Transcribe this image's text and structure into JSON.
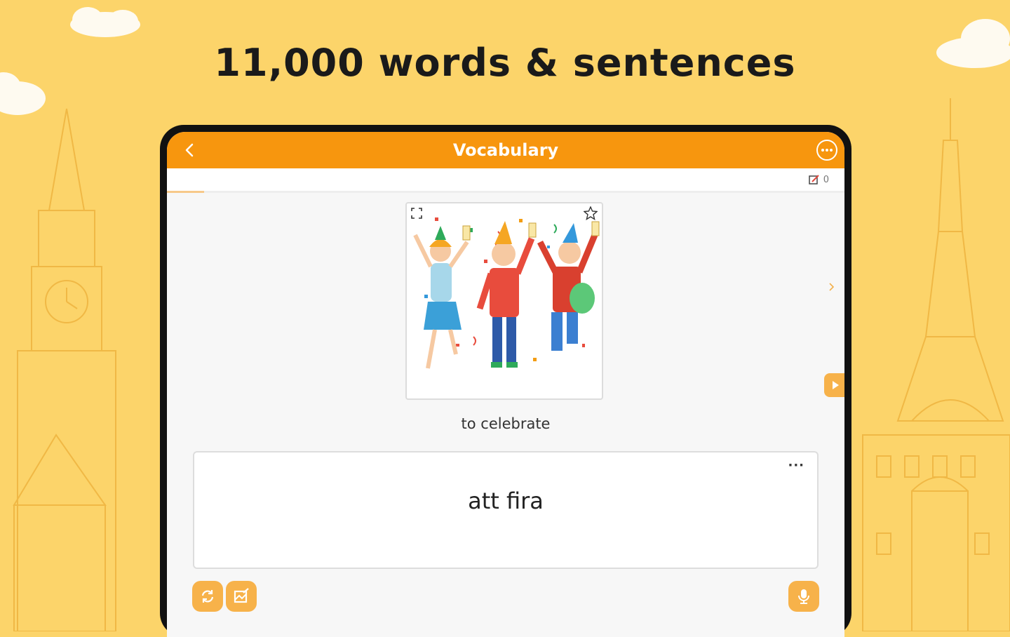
{
  "headline": "11,000 words & sentences",
  "appbar": {
    "title": "Vocabulary",
    "back_icon": "chevron-left-icon",
    "more_icon": "more-horizontal-icon"
  },
  "counter": {
    "icon": "edit-note-icon",
    "value": "0"
  },
  "progress": {
    "fraction": 0.055
  },
  "card": {
    "image_description_icon": "party-celebration-illustration",
    "english": "to celebrate",
    "target": "att fira",
    "more_label": "···"
  },
  "colors": {
    "background": "#fcd46a",
    "accent": "#f7960e",
    "button": "#f7b24a"
  }
}
